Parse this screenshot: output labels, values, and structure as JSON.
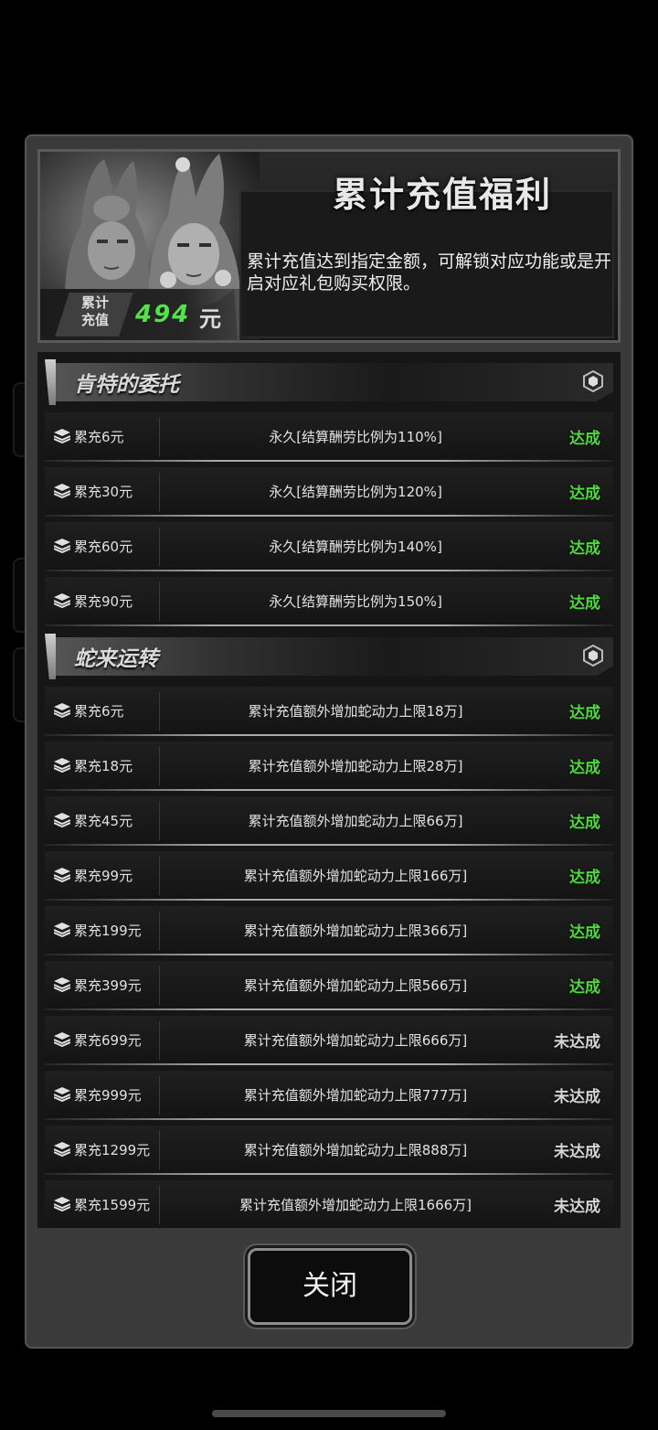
{
  "header": {
    "title": "累计充值福利",
    "description": "累计充值达到指定金额，可解锁对应功能或是开启对应礼包购买权限。",
    "recharge_label_line1": "累计",
    "recharge_label_line2": "充值",
    "recharge_amount": "494",
    "recharge_unit": "元"
  },
  "sections": [
    {
      "title": "肯特的委托",
      "rows": [
        {
          "amount": "累充6元",
          "desc": "永久[结算酬劳比例为110%]",
          "status": "达成"
        },
        {
          "amount": "累充30元",
          "desc": "永久[结算酬劳比例为120%]",
          "status": "达成"
        },
        {
          "amount": "累充60元",
          "desc": "永久[结算酬劳比例为140%]",
          "status": "达成"
        },
        {
          "amount": "累充90元",
          "desc": "永久[结算酬劳比例为150%]",
          "status": "达成"
        }
      ]
    },
    {
      "title": "蛇来运转",
      "rows": [
        {
          "amount": "累充6元",
          "desc": "累计充值额外增加蛇动力上限18万]",
          "status": "达成"
        },
        {
          "amount": "累充18元",
          "desc": "累计充值额外增加蛇动力上限28万]",
          "status": "达成"
        },
        {
          "amount": "累充45元",
          "desc": "累计充值额外增加蛇动力上限66万]",
          "status": "达成"
        },
        {
          "amount": "累充99元",
          "desc": "累计充值额外增加蛇动力上限166万]",
          "status": "达成"
        },
        {
          "amount": "累充199元",
          "desc": "累计充值额外增加蛇动力上限366万]",
          "status": "达成"
        },
        {
          "amount": "累充399元",
          "desc": "累计充值额外增加蛇动力上限566万]",
          "status": "达成"
        },
        {
          "amount": "累充699元",
          "desc": "累计充值额外增加蛇动力上限666万]",
          "status": "未达成"
        },
        {
          "amount": "累充999元",
          "desc": "累计充值额外增加蛇动力上限777万]",
          "status": "未达成"
        },
        {
          "amount": "累充1299元",
          "desc": "累计充值额外增加蛇动力上限888万]",
          "status": "未达成"
        },
        {
          "amount": "累充1599元",
          "desc": "累计充值额外增加蛇动力上限1666万]",
          "status": "未达成"
        }
      ]
    }
  ],
  "close_label": "关闭",
  "colors": {
    "achieved": "#4fd93f",
    "not_achieved": "#d5d5d5",
    "amount_green": "#53e24b"
  },
  "icons": {
    "row_icon": "layers-icon",
    "section_icon": "hexagon-icon"
  }
}
